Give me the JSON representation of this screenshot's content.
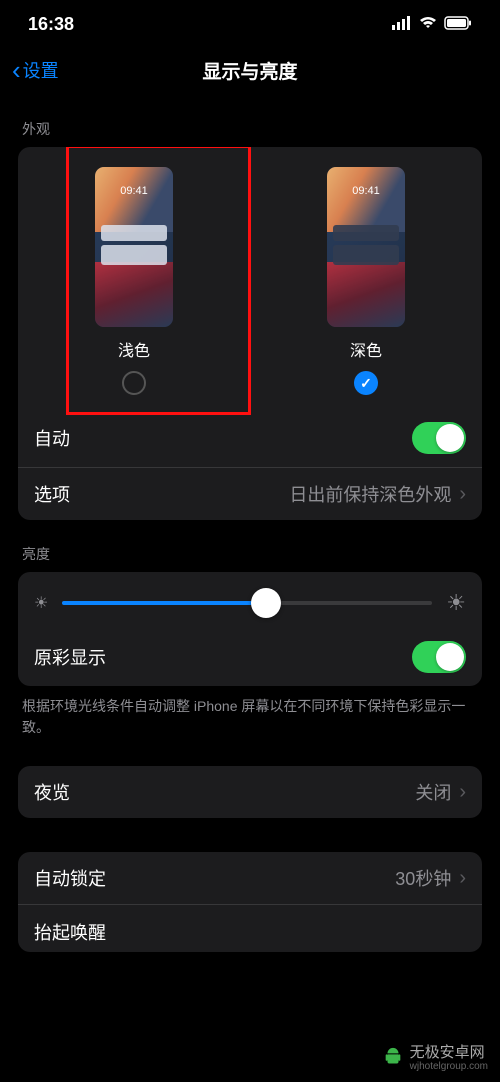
{
  "status": {
    "time": "16:38"
  },
  "nav": {
    "back": "设置",
    "title": "显示与亮度"
  },
  "appearance": {
    "header": "外观",
    "preview_time": "09:41",
    "light_label": "浅色",
    "dark_label": "深色",
    "auto_label": "自动",
    "options_label": "选项",
    "options_value": "日出前保持深色外观"
  },
  "brightness": {
    "header": "亮度",
    "true_tone_label": "原彩显示",
    "footer": "根据环境光线条件自动调整 iPhone 屏幕以在不同环境下保持色彩显示一致。",
    "slider_value": 55
  },
  "night_shift": {
    "label": "夜览",
    "value": "关闭"
  },
  "auto_lock": {
    "label": "自动锁定",
    "value": "30秒钟"
  },
  "raise_to_wake": {
    "label": "抬起唤醒"
  },
  "watermark": "无极安卓网",
  "watermark_url": "wjhotelgroup.com"
}
